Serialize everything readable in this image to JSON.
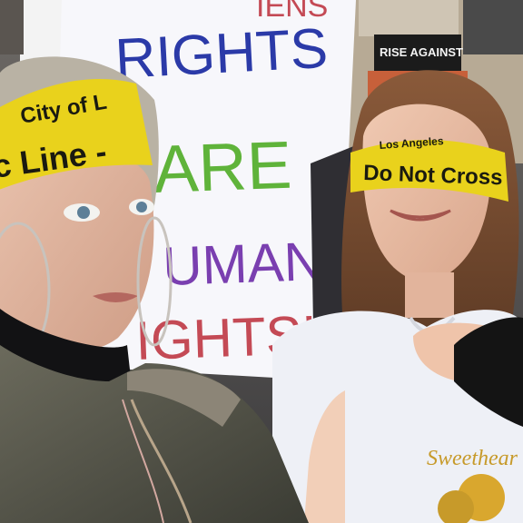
{
  "protest_sign": {
    "line1": "RIGHTS",
    "line2": "ARE",
    "line3": "UMAN",
    "line4": "IGHTS!",
    "top_fragment": "IENS",
    "colors": {
      "blue": "#2b3aa8",
      "green": "#5fb33a",
      "purple": "#7a3fb0",
      "red": "#c44a55"
    }
  },
  "background_sign": {
    "text": "RISE AGAINST",
    "colors": {
      "bg": "#1b1b1b",
      "text": "#f4f4f4"
    }
  },
  "left_tape": {
    "line1": "City of L",
    "line2": "c Line - ",
    "colors": {
      "tape": "#e9d21c",
      "text": "#1a1a10"
    }
  },
  "right_tape": {
    "line1": "Los Angeles",
    "line2": "Do Not Cross",
    "colors": {
      "tape": "#e9d21c",
      "text": "#1a1a10"
    }
  },
  "shirt": {
    "print_text": "Sweethear",
    "colors": {
      "shirt": "#eef0f6",
      "print": "#c79a2a"
    }
  }
}
